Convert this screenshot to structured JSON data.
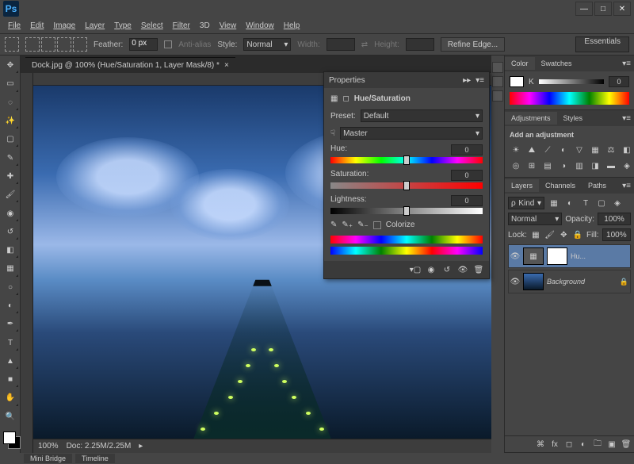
{
  "app": {
    "logo": "Ps"
  },
  "menus": [
    "File",
    "Edit",
    "Image",
    "Layer",
    "Type",
    "Select",
    "Filter",
    "3D",
    "View",
    "Window",
    "Help"
  ],
  "options": {
    "feather_label": "Feather:",
    "feather": "0 px",
    "antialias": "Anti-alias",
    "style_label": "Style:",
    "style": "Normal",
    "width_label": "Width:",
    "height_label": "Height:",
    "refine": "Refine Edge..."
  },
  "workspace_button": "Essentials",
  "doc_tab": "Dock.jpg @ 100% (Hue/Saturation 1, Layer Mask/8) *",
  "status": {
    "zoom": "100%",
    "doc": "Doc: 2.25M/2.25M"
  },
  "bottom_tabs": [
    "Mini Bridge",
    "Timeline"
  ],
  "panels": {
    "color": {
      "tabs": [
        "Color",
        "Swatches"
      ],
      "channel": "K",
      "value": "0"
    },
    "adjustments": {
      "tabs": [
        "Adjustments",
        "Styles"
      ],
      "hint": "Add an adjustment"
    },
    "layers": {
      "tabs": [
        "Layers",
        "Channels",
        "Paths"
      ],
      "filter": "Kind",
      "blend": "Normal",
      "opacity_label": "Opacity:",
      "opacity": "100%",
      "lock_label": "Lock:",
      "fill_label": "Fill:",
      "fill": "100%",
      "items": [
        {
          "name": "Hu...",
          "adjustment": true
        },
        {
          "name": "Background",
          "locked": true,
          "adjustment": false
        }
      ]
    }
  },
  "properties": {
    "panel_label": "Properties",
    "title": "Hue/Saturation",
    "preset_label": "Preset:",
    "preset": "Default",
    "range": "Master",
    "hue_label": "Hue:",
    "hue": "0",
    "sat_label": "Saturation:",
    "sat": "0",
    "light_label": "Lightness:",
    "light": "0",
    "colorize": "Colorize"
  }
}
